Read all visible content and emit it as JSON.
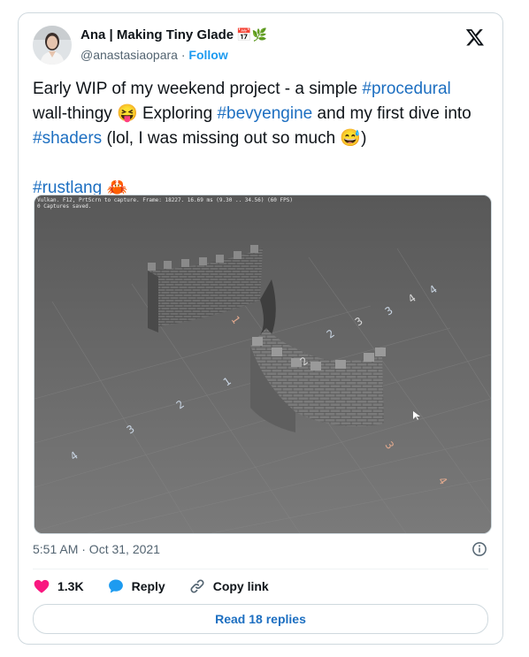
{
  "author": {
    "display_name": "Ana | Making Tiny Glade",
    "name_emojis": "📅🌿",
    "handle": "@anastasiaopara",
    "separator": "·",
    "follow_label": "Follow"
  },
  "tweet": {
    "segments": [
      {
        "text": "Early WIP of my weekend project - a simple ",
        "type": "text"
      },
      {
        "text": "#procedural",
        "type": "hashtag"
      },
      {
        "text": " wall-thingy 😝 Exploring  ",
        "type": "text"
      },
      {
        "text": "#bevyengine",
        "type": "hashtag"
      },
      {
        "text": " and my first dive into ",
        "type": "text"
      },
      {
        "text": "#shaders",
        "type": "hashtag"
      },
      {
        "text": " (lol, I was missing out so much 😅)",
        "type": "text"
      }
    ],
    "hashtag_line": "#rustlang",
    "hashtag_line_emoji": "🦀"
  },
  "media": {
    "hud_line_1": "Vulkan. F12, PrtScrn to capture. Frame: 18227. 16.69 ms (9.30 .. 34.56) (60 FPS)",
    "hud_line_2": "0 Captures saved.",
    "floor_labels": [
      "4",
      "3",
      "2",
      "1",
      "2",
      "3",
      "4",
      "3",
      "4",
      "1",
      "2",
      "3",
      "4"
    ]
  },
  "timestamp": "5:51 AM · Oct 31, 2021",
  "actions": {
    "likes": "1.3K",
    "reply_label": "Reply",
    "copy_link_label": "Copy link"
  },
  "read_replies_label": "Read 18 replies",
  "colors": {
    "link": "#1d6fc1",
    "like": "#f91880",
    "reply": "#1d9bf0",
    "border": "#cfd9de"
  }
}
